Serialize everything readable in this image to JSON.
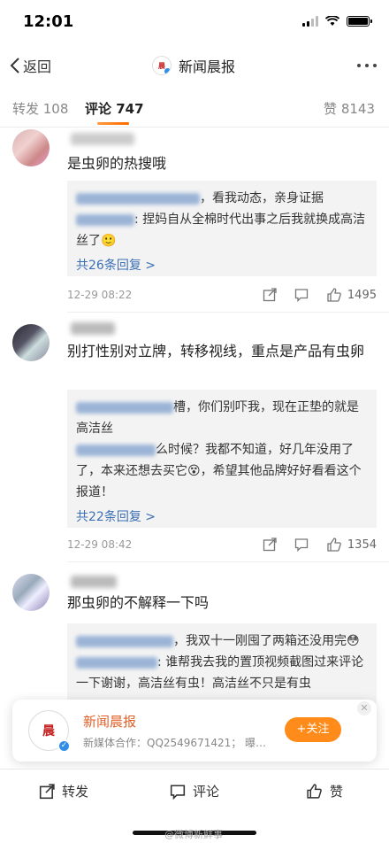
{
  "status": {
    "time": "12:01"
  },
  "nav": {
    "back_label": "返回",
    "title": "新闻晨报",
    "logo_text": "新闻晨报"
  },
  "tabs": {
    "repost": "转发 108",
    "comment": "评论 747",
    "like": "赞 8143"
  },
  "comments": [
    {
      "text": "是虫卵的热搜哦",
      "replies": [
        "，看我动态，亲身证据",
        ": 捏妈自从全棉时代出事之后我就换成高洁丝了🙂"
      ],
      "more": "共26条回复 >",
      "time": "12-29 08:22",
      "likes": "1495"
    },
    {
      "text": "别打性别对立牌，转移视线，重点是产品有虫卵",
      "replies": [
        "槽，你们别吓我，现在正垫的就是高洁丝",
        "么时候？我都不知道，好几年没用了了，本来还想去买它😵，希望其他品牌好好看看这个报道！"
      ],
      "more": "共22条回复 >",
      "time": "12-29 08:42",
      "likes": "1354"
    },
    {
      "text": "那虫卵的不解释一下吗",
      "replies": [
        "，我双十一刚囤了两箱还没用完😳",
        ": 谁帮我去我的置顶视频截图过来评论一下谢谢，高洁丝有虫！高洁丝不只是有虫"
      ]
    }
  ],
  "card": {
    "name": "新闻晨报",
    "desc": "新媒体合作：QQ2549671421；  曝…",
    "follow": "+关注",
    "logo_text": "新闻晨报"
  },
  "bottom": {
    "repost": "转发",
    "comment": "评论",
    "like": "赞"
  },
  "watermark": "@微博新鲜事"
}
